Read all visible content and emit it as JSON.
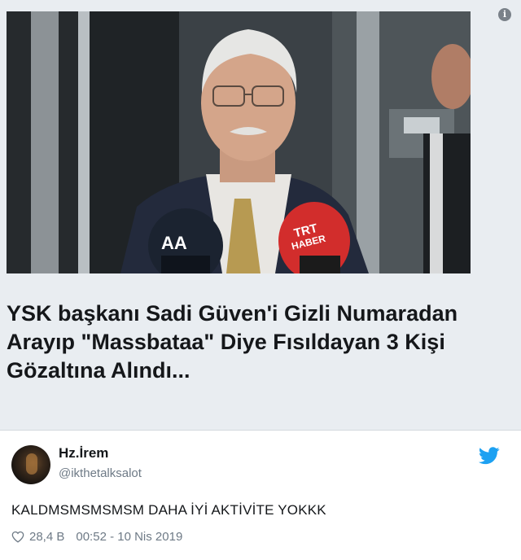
{
  "card": {
    "headline": "YSK başkanı Sadi Güven'i Gizli Numaradan Arayıp \"Massbataa\" Diye Fısıldayan 3 Kişi Gözaltına Alındı...",
    "photo": {
      "mic1_label": "AA",
      "mic2_label_top": "TRT",
      "mic2_label_bottom": "HABER"
    },
    "info_icon": "i"
  },
  "tweet": {
    "name": "Hz.İrem",
    "handle": "@ikthetalksalot",
    "text": "KALDMSMSMSMSM DAHA İYİ AKTİVİTE YOKKK",
    "likes": "28,4 B",
    "time": "00:52 - 10 Nis 2019",
    "icons": {
      "avatar": "avatar",
      "bird": "twitter-bird-icon",
      "like": "heart-icon"
    },
    "colors": {
      "twitter_blue": "#1da1f2",
      "muted": "#6e7a86"
    }
  }
}
